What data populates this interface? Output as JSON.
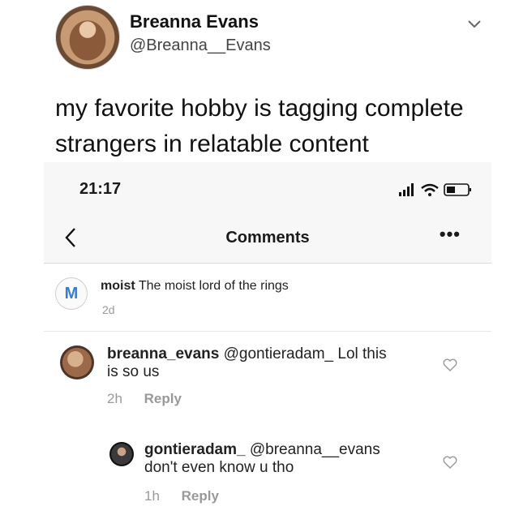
{
  "tweet": {
    "name": "Breanna Evans",
    "handle": "@Breanna__Evans",
    "text": "my favorite hobby is tagging complete strangers in relatable content"
  },
  "phone": {
    "status_time": "21:17",
    "nav_title": "Comments",
    "more_label": "•••"
  },
  "caption": {
    "avatar_letter": "M",
    "user": "moist",
    "text": "The moist lord of the rings",
    "time": "2d"
  },
  "comments": [
    {
      "user": "breanna_evans",
      "text_line1": "@gontieradam_  Lol this",
      "text_line2": "is so us",
      "time": "2h",
      "reply": "Reply"
    },
    {
      "user": "gontieradam_",
      "text_line1": "@breanna__evans",
      "text_line2": "don't even know u tho",
      "time": "1h",
      "reply": "Reply"
    }
  ],
  "icons": [
    "chevron-down-icon",
    "signal-icon",
    "wifi-icon",
    "battery-icon",
    "back-arrow-icon",
    "more-icon",
    "heart-icon"
  ]
}
